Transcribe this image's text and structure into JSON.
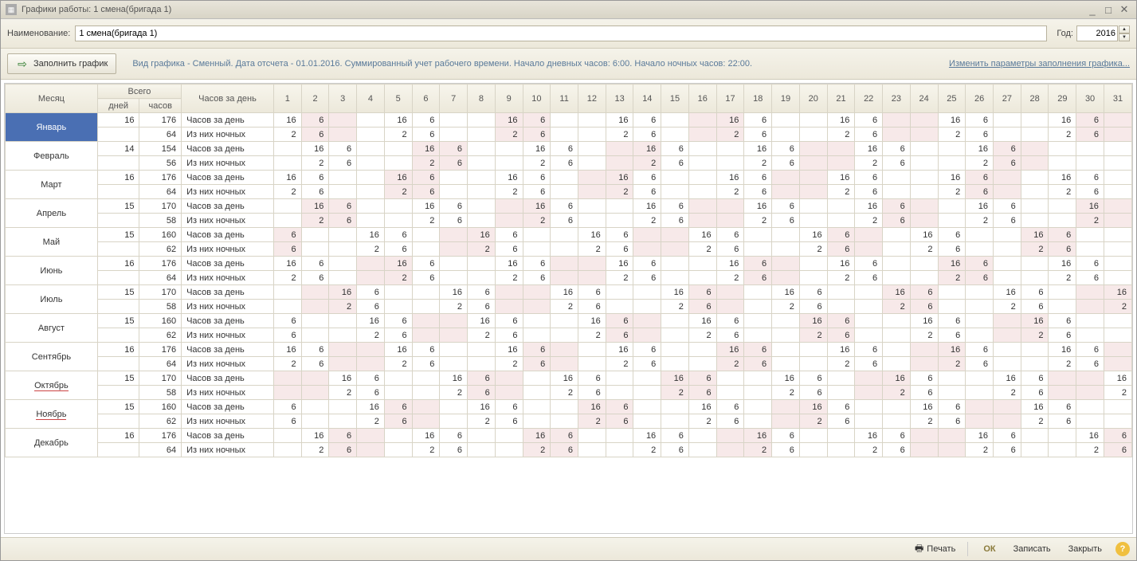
{
  "window": {
    "title": "Графики работы: 1 смена(бригада 1)"
  },
  "labels": {
    "name": "Наименование:",
    "year": "Год:",
    "fill": "Заполнить график",
    "link": "Изменить параметры заполнения графика...",
    "print": "Печать",
    "ok": "ОК",
    "save": "Записать",
    "close": "Закрыть",
    "help": "?"
  },
  "values": {
    "name": "1 смена(бригада 1)",
    "year": "2016",
    "info": "Вид графика - Сменный. Дата отсчета - 01.01.2016. Суммированный учет рабочего времени. Начало дневных часов: 6:00. Начало ночных часов: 22:00."
  },
  "headers": {
    "month": "Месяц",
    "total": "Всего",
    "days": "дней",
    "hours": "часов",
    "perday": "Часов за день"
  },
  "rowlabels": {
    "h": "Часов за день",
    "n": "Из них ночных"
  },
  "months": [
    {
      "name": "Январь",
      "sel": true,
      "days": 16,
      "hours": 176,
      "night": 64,
      "start": 5,
      "h": [
        "16",
        "6",
        "",
        "",
        "16",
        "6",
        "",
        "",
        "16",
        "6",
        "",
        "",
        "16",
        "6",
        "",
        "",
        "16",
        "6",
        "",
        "",
        "16",
        "6",
        "",
        "",
        "16",
        "6",
        "",
        "",
        "16",
        "6",
        ""
      ],
      "n": [
        "2",
        "6",
        "",
        "",
        "2",
        "6",
        "",
        "",
        "2",
        "6",
        "",
        "",
        "2",
        "6",
        "",
        "",
        "2",
        "6",
        "",
        "",
        "2",
        "6",
        "",
        "",
        "2",
        "6",
        "",
        "",
        "2",
        "6",
        ""
      ]
    },
    {
      "name": "Февраль",
      "days": 14,
      "hours": 154,
      "night": 56,
      "start": 1,
      "h": [
        "",
        "16",
        "6",
        "",
        "",
        "16",
        "6",
        "",
        "",
        "16",
        "6",
        "",
        "",
        "16",
        "6",
        "",
        "",
        "16",
        "6",
        "",
        "",
        "16",
        "6",
        "",
        "",
        "16",
        "6",
        "",
        "",
        "",
        ""
      ],
      "n": [
        "",
        "2",
        "6",
        "",
        "",
        "2",
        "6",
        "",
        "",
        "2",
        "6",
        "",
        "",
        "2",
        "6",
        "",
        "",
        "2",
        "6",
        "",
        "",
        "2",
        "6",
        "",
        "",
        "2",
        "6",
        "",
        "",
        "",
        ""
      ]
    },
    {
      "name": "Март",
      "days": 16,
      "hours": 176,
      "night": 64,
      "start": 2,
      "h": [
        "16",
        "6",
        "",
        "",
        "16",
        "6",
        "",
        "",
        "16",
        "6",
        "",
        "",
        "16",
        "6",
        "",
        "",
        "16",
        "6",
        "",
        "",
        "16",
        "6",
        "",
        "",
        "16",
        "6",
        "",
        "",
        "16",
        "6",
        ""
      ],
      "n": [
        "2",
        "6",
        "",
        "",
        "2",
        "6",
        "",
        "",
        "2",
        "6",
        "",
        "",
        "2",
        "6",
        "",
        "",
        "2",
        "6",
        "",
        "",
        "2",
        "6",
        "",
        "",
        "2",
        "6",
        "",
        "",
        "2",
        "6",
        ""
      ]
    },
    {
      "name": "Апрель",
      "days": 15,
      "hours": 170,
      "night": 58,
      "start": 5,
      "h": [
        "",
        "16",
        "6",
        "",
        "",
        "16",
        "6",
        "",
        "",
        "16",
        "6",
        "",
        "",
        "16",
        "6",
        "",
        "",
        "16",
        "6",
        "",
        "",
        "16",
        "6",
        "",
        "",
        "16",
        "6",
        "",
        "",
        "16",
        ""
      ],
      "n": [
        "",
        "2",
        "6",
        "",
        "",
        "2",
        "6",
        "",
        "",
        "2",
        "6",
        "",
        "",
        "2",
        "6",
        "",
        "",
        "2",
        "6",
        "",
        "",
        "2",
        "6",
        "",
        "",
        "2",
        "6",
        "",
        "",
        "2",
        ""
      ]
    },
    {
      "name": "Май",
      "days": 15,
      "hours": 160,
      "night": 62,
      "start": 0,
      "h": [
        "6",
        "",
        "",
        "16",
        "6",
        "",
        "",
        "16",
        "6",
        "",
        "",
        "16",
        "6",
        "",
        "",
        "16",
        "6",
        "",
        "",
        "16",
        "6",
        "",
        "",
        "16",
        "6",
        "",
        "",
        "16",
        "6",
        "",
        ""
      ],
      "n": [
        "6",
        "",
        "",
        "2",
        "6",
        "",
        "",
        "2",
        "6",
        "",
        "",
        "2",
        "6",
        "",
        "",
        "2",
        "6",
        "",
        "",
        "2",
        "6",
        "",
        "",
        "2",
        "6",
        "",
        "",
        "2",
        "6",
        "",
        ""
      ]
    },
    {
      "name": "Июнь",
      "days": 16,
      "hours": 176,
      "night": 64,
      "start": 3,
      "h": [
        "16",
        "6",
        "",
        "",
        "16",
        "6",
        "",
        "",
        "16",
        "6",
        "",
        "",
        "16",
        "6",
        "",
        "",
        "16",
        "6",
        "",
        "",
        "16",
        "6",
        "",
        "",
        "16",
        "6",
        "",
        "",
        "16",
        "6",
        ""
      ],
      "n": [
        "2",
        "6",
        "",
        "",
        "2",
        "6",
        "",
        "",
        "2",
        "6",
        "",
        "",
        "2",
        "6",
        "",
        "",
        "2",
        "6",
        "",
        "",
        "2",
        "6",
        "",
        "",
        "2",
        "6",
        "",
        "",
        "2",
        "6",
        ""
      ]
    },
    {
      "name": "Июль",
      "days": 15,
      "hours": 170,
      "night": 58,
      "start": 5,
      "h": [
        "",
        "",
        "16",
        "6",
        "",
        "",
        "16",
        "6",
        "",
        "",
        "16",
        "6",
        "",
        "",
        "16",
        "6",
        "",
        "",
        "16",
        "6",
        "",
        "",
        "16",
        "6",
        "",
        "",
        "16",
        "6",
        "",
        "",
        "16"
      ],
      "n": [
        "",
        "",
        "2",
        "6",
        "",
        "",
        "2",
        "6",
        "",
        "",
        "2",
        "6",
        "",
        "",
        "2",
        "6",
        "",
        "",
        "2",
        "6",
        "",
        "",
        "2",
        "6",
        "",
        "",
        "2",
        "6",
        "",
        "",
        "2"
      ]
    },
    {
      "name": "Август",
      "days": 15,
      "hours": 160,
      "night": 62,
      "start": 1,
      "h": [
        "6",
        "",
        "",
        "16",
        "6",
        "",
        "",
        "16",
        "6",
        "",
        "",
        "16",
        "6",
        "",
        "",
        "16",
        "6",
        "",
        "",
        "16",
        "6",
        "",
        "",
        "16",
        "6",
        "",
        "",
        "16",
        "6",
        "",
        ""
      ],
      "n": [
        "6",
        "",
        "",
        "2",
        "6",
        "",
        "",
        "2",
        "6",
        "",
        "",
        "2",
        "6",
        "",
        "",
        "2",
        "6",
        "",
        "",
        "2",
        "6",
        "",
        "",
        "2",
        "6",
        "",
        "",
        "2",
        "6",
        "",
        ""
      ]
    },
    {
      "name": "Сентябрь",
      "days": 16,
      "hours": 176,
      "night": 64,
      "start": 4,
      "h": [
        "16",
        "6",
        "",
        "",
        "16",
        "6",
        "",
        "",
        "16",
        "6",
        "",
        "",
        "16",
        "6",
        "",
        "",
        "16",
        "6",
        "",
        "",
        "16",
        "6",
        "",
        "",
        "16",
        "6",
        "",
        "",
        "16",
        "6",
        ""
      ],
      "n": [
        "2",
        "6",
        "",
        "",
        "2",
        "6",
        "",
        "",
        "2",
        "6",
        "",
        "",
        "2",
        "6",
        "",
        "",
        "2",
        "6",
        "",
        "",
        "2",
        "6",
        "",
        "",
        "2",
        "6",
        "",
        "",
        "2",
        "6",
        ""
      ]
    },
    {
      "name": "Октябрь",
      "underline": true,
      "days": 15,
      "hours": 170,
      "night": 58,
      "start": 6,
      "h": [
        "",
        "",
        "16",
        "6",
        "",
        "",
        "16",
        "6",
        "",
        "",
        "16",
        "6",
        "",
        "",
        "16",
        "6",
        "",
        "",
        "16",
        "6",
        "",
        "",
        "16",
        "6",
        "",
        "",
        "16",
        "6",
        "",
        "",
        "16"
      ],
      "n": [
        "",
        "",
        "2",
        "6",
        "",
        "",
        "2",
        "6",
        "",
        "",
        "2",
        "6",
        "",
        "",
        "2",
        "6",
        "",
        "",
        "2",
        "6",
        "",
        "",
        "2",
        "6",
        "",
        "",
        "2",
        "6",
        "",
        "",
        "2"
      ]
    },
    {
      "name": "Ноябрь",
      "underline": true,
      "days": 15,
      "hours": 160,
      "night": 62,
      "start": 2,
      "h": [
        "6",
        "",
        "",
        "16",
        "6",
        "",
        "",
        "16",
        "6",
        "",
        "",
        "16",
        "6",
        "",
        "",
        "16",
        "6",
        "",
        "",
        "16",
        "6",
        "",
        "",
        "16",
        "6",
        "",
        "",
        "16",
        "6",
        "",
        ""
      ],
      "n": [
        "6",
        "",
        "",
        "2",
        "6",
        "",
        "",
        "2",
        "6",
        "",
        "",
        "2",
        "6",
        "",
        "",
        "2",
        "6",
        "",
        "",
        "2",
        "6",
        "",
        "",
        "2",
        "6",
        "",
        "",
        "2",
        "6",
        "",
        ""
      ]
    },
    {
      "name": "Декабрь",
      "days": 16,
      "hours": 176,
      "night": 64,
      "start": 4,
      "h": [
        "",
        "16",
        "6",
        "",
        "",
        "16",
        "6",
        "",
        "",
        "16",
        "6",
        "",
        "",
        "16",
        "6",
        "",
        "",
        "16",
        "6",
        "",
        "",
        "16",
        "6",
        "",
        "",
        "16",
        "6",
        "",
        "",
        "16",
        "6"
      ],
      "n": [
        "",
        "2",
        "6",
        "",
        "",
        "2",
        "6",
        "",
        "",
        "2",
        "6",
        "",
        "",
        "2",
        "6",
        "",
        "",
        "2",
        "6",
        "",
        "",
        "2",
        "6",
        "",
        "",
        "2",
        "6",
        "",
        "",
        "2",
        "6"
      ]
    }
  ]
}
